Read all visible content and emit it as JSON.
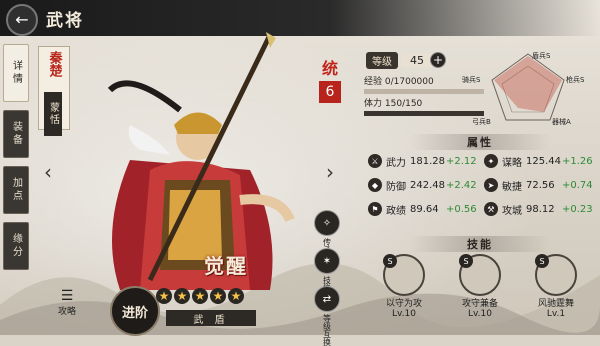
{
  "header": {
    "title": "武将",
    "back_icon": "back-arrow-icon"
  },
  "tabs": [
    {
      "label": "详情",
      "active": true
    },
    {
      "label": "装备",
      "active": false
    },
    {
      "label": "加点",
      "active": false
    },
    {
      "label": "缘分",
      "active": false
    }
  ],
  "hero": {
    "faction": "秦楚",
    "name": "蒙恬",
    "command_label": "统",
    "command_value": "6",
    "awaken_label": "觉醒",
    "role": "武 盾",
    "stars": 5
  },
  "level": {
    "label": "等级",
    "value": "45",
    "plus_icon": "plus-icon"
  },
  "exp": {
    "label": "经验",
    "value": "0/1700000",
    "fraction": 0.0
  },
  "stamina": {
    "label": "体力",
    "value": "150/150",
    "fraction": 1.0
  },
  "radar": {
    "labels": [
      "盾兵S",
      "枪兵S",
      "器械A",
      "弓兵B",
      "骑兵S"
    ],
    "colors": [
      "#c0392b",
      "#8e44ad",
      "#6b5bd6",
      "#2e7fd8",
      "#c0392b"
    ]
  },
  "attributes": {
    "title": "属性",
    "items": [
      {
        "name": "武力",
        "value": "181.28",
        "bonus": "+2.12"
      },
      {
        "name": "谋略",
        "value": "125.44",
        "bonus": "+1.26"
      },
      {
        "name": "防御",
        "value": "242.48",
        "bonus": "+2.42"
      },
      {
        "name": "敏捷",
        "value": "72.56",
        "bonus": "+0.74"
      },
      {
        "name": "政绩",
        "value": "89.64",
        "bonus": "+0.56"
      },
      {
        "name": "攻城",
        "value": "98.12",
        "bonus": "+0.23"
      }
    ]
  },
  "skills": {
    "title": "技能",
    "items": [
      {
        "name": "以守为攻",
        "level": "Lv.10",
        "grade": "S"
      },
      {
        "name": "攻守兼备",
        "level": "Lv.10",
        "grade": "S"
      },
      {
        "name": "风驰霆舞",
        "level": "Lv.1",
        "grade": "S"
      }
    ]
  },
  "bottom": {
    "strategy_label": "攻略",
    "advance_label": "进阶"
  },
  "side_buttons": [
    {
      "label": "传承"
    },
    {
      "label": "技能"
    },
    {
      "label": "等级互换"
    }
  ]
}
